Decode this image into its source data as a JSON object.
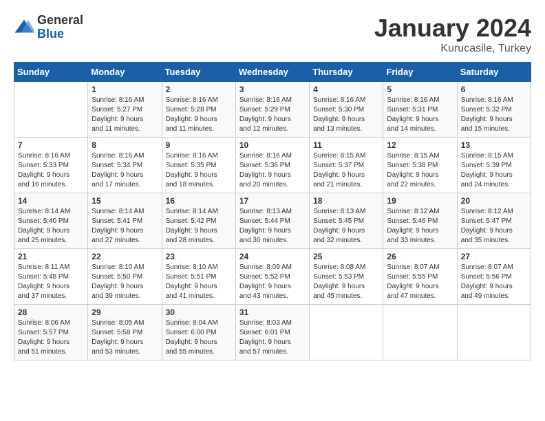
{
  "logo": {
    "general": "General",
    "blue": "Blue"
  },
  "title": "January 2024",
  "subtitle": "Kurucasile, Turkey",
  "days_of_week": [
    "Sunday",
    "Monday",
    "Tuesday",
    "Wednesday",
    "Thursday",
    "Friday",
    "Saturday"
  ],
  "weeks": [
    [
      {
        "day": "",
        "info": ""
      },
      {
        "day": "1",
        "info": "Sunrise: 8:16 AM\nSunset: 5:27 PM\nDaylight: 9 hours\nand 11 minutes."
      },
      {
        "day": "2",
        "info": "Sunrise: 8:16 AM\nSunset: 5:28 PM\nDaylight: 9 hours\nand 11 minutes."
      },
      {
        "day": "3",
        "info": "Sunrise: 8:16 AM\nSunset: 5:29 PM\nDaylight: 9 hours\nand 12 minutes."
      },
      {
        "day": "4",
        "info": "Sunrise: 8:16 AM\nSunset: 5:30 PM\nDaylight: 9 hours\nand 13 minutes."
      },
      {
        "day": "5",
        "info": "Sunrise: 8:16 AM\nSunset: 5:31 PM\nDaylight: 9 hours\nand 14 minutes."
      },
      {
        "day": "6",
        "info": "Sunrise: 8:16 AM\nSunset: 5:32 PM\nDaylight: 9 hours\nand 15 minutes."
      }
    ],
    [
      {
        "day": "7",
        "info": "Sunrise: 8:16 AM\nSunset: 5:33 PM\nDaylight: 9 hours\nand 16 minutes."
      },
      {
        "day": "8",
        "info": "Sunrise: 8:16 AM\nSunset: 5:34 PM\nDaylight: 9 hours\nand 17 minutes."
      },
      {
        "day": "9",
        "info": "Sunrise: 8:16 AM\nSunset: 5:35 PM\nDaylight: 9 hours\nand 18 minutes."
      },
      {
        "day": "10",
        "info": "Sunrise: 8:16 AM\nSunset: 5:36 PM\nDaylight: 9 hours\nand 20 minutes."
      },
      {
        "day": "11",
        "info": "Sunrise: 8:15 AM\nSunset: 5:37 PM\nDaylight: 9 hours\nand 21 minutes."
      },
      {
        "day": "12",
        "info": "Sunrise: 8:15 AM\nSunset: 5:38 PM\nDaylight: 9 hours\nand 22 minutes."
      },
      {
        "day": "13",
        "info": "Sunrise: 8:15 AM\nSunset: 5:39 PM\nDaylight: 9 hours\nand 24 minutes."
      }
    ],
    [
      {
        "day": "14",
        "info": "Sunrise: 8:14 AM\nSunset: 5:40 PM\nDaylight: 9 hours\nand 25 minutes."
      },
      {
        "day": "15",
        "info": "Sunrise: 8:14 AM\nSunset: 5:41 PM\nDaylight: 9 hours\nand 27 minutes."
      },
      {
        "day": "16",
        "info": "Sunrise: 8:14 AM\nSunset: 5:42 PM\nDaylight: 9 hours\nand 28 minutes."
      },
      {
        "day": "17",
        "info": "Sunrise: 8:13 AM\nSunset: 5:44 PM\nDaylight: 9 hours\nand 30 minutes."
      },
      {
        "day": "18",
        "info": "Sunrise: 8:13 AM\nSunset: 5:45 PM\nDaylight: 9 hours\nand 32 minutes."
      },
      {
        "day": "19",
        "info": "Sunrise: 8:12 AM\nSunset: 5:46 PM\nDaylight: 9 hours\nand 33 minutes."
      },
      {
        "day": "20",
        "info": "Sunrise: 8:12 AM\nSunset: 5:47 PM\nDaylight: 9 hours\nand 35 minutes."
      }
    ],
    [
      {
        "day": "21",
        "info": "Sunrise: 8:11 AM\nSunset: 5:48 PM\nDaylight: 9 hours\nand 37 minutes."
      },
      {
        "day": "22",
        "info": "Sunrise: 8:10 AM\nSunset: 5:50 PM\nDaylight: 9 hours\nand 39 minutes."
      },
      {
        "day": "23",
        "info": "Sunrise: 8:10 AM\nSunset: 5:51 PM\nDaylight: 9 hours\nand 41 minutes."
      },
      {
        "day": "24",
        "info": "Sunrise: 8:09 AM\nSunset: 5:52 PM\nDaylight: 9 hours\nand 43 minutes."
      },
      {
        "day": "25",
        "info": "Sunrise: 8:08 AM\nSunset: 5:53 PM\nDaylight: 9 hours\nand 45 minutes."
      },
      {
        "day": "26",
        "info": "Sunrise: 8:07 AM\nSunset: 5:55 PM\nDaylight: 9 hours\nand 47 minutes."
      },
      {
        "day": "27",
        "info": "Sunrise: 8:07 AM\nSunset: 5:56 PM\nDaylight: 9 hours\nand 49 minutes."
      }
    ],
    [
      {
        "day": "28",
        "info": "Sunrise: 8:06 AM\nSunset: 5:57 PM\nDaylight: 9 hours\nand 51 minutes."
      },
      {
        "day": "29",
        "info": "Sunrise: 8:05 AM\nSunset: 5:58 PM\nDaylight: 9 hours\nand 53 minutes."
      },
      {
        "day": "30",
        "info": "Sunrise: 8:04 AM\nSunset: 6:00 PM\nDaylight: 9 hours\nand 55 minutes."
      },
      {
        "day": "31",
        "info": "Sunrise: 8:03 AM\nSunset: 6:01 PM\nDaylight: 9 hours\nand 57 minutes."
      },
      {
        "day": "",
        "info": ""
      },
      {
        "day": "",
        "info": ""
      },
      {
        "day": "",
        "info": ""
      }
    ]
  ]
}
